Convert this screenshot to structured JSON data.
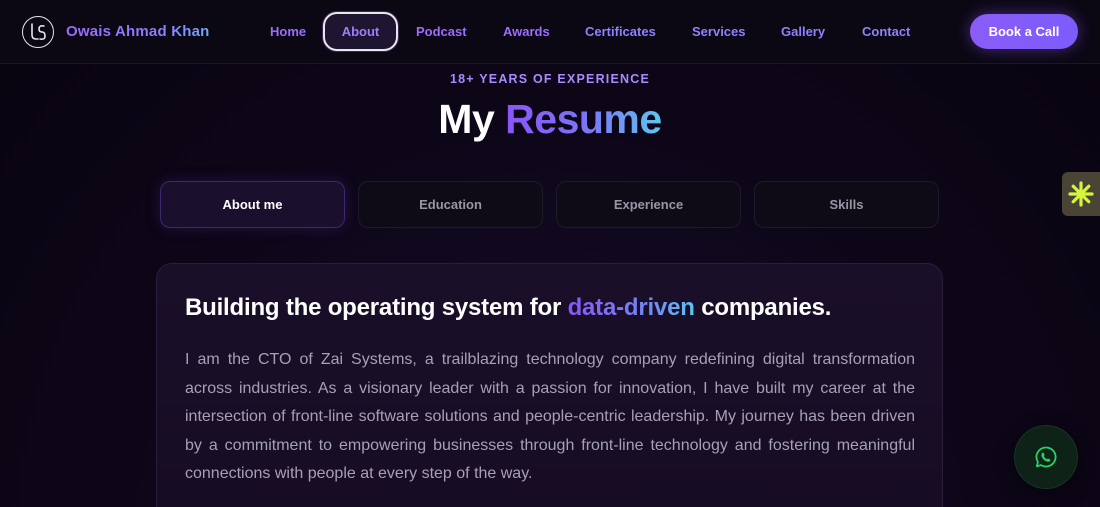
{
  "nav": {
    "brand": "Owais Ahmad Khan",
    "links": [
      {
        "label": "Home"
      },
      {
        "label": "About"
      },
      {
        "label": "Podcast"
      },
      {
        "label": "Awards"
      },
      {
        "label": "Certificates"
      },
      {
        "label": "Services"
      },
      {
        "label": "Gallery"
      },
      {
        "label": "Contact"
      }
    ],
    "active": "About",
    "cta": "Book a Call",
    "logo_icon": "monogram-logo-icon"
  },
  "hero": {
    "kicker": "18+ YEARS OF EXPERIENCE",
    "title_a": "My",
    "title_b": "Resume"
  },
  "tabs": [
    {
      "label": "About me",
      "active": true
    },
    {
      "label": "Education",
      "active": false
    },
    {
      "label": "Experience",
      "active": false
    },
    {
      "label": "Skills",
      "active": false
    }
  ],
  "card": {
    "title_before": "Building the operating system for",
    "title_highlight": "data-driven",
    "title_after": "companies.",
    "body": "I am the CTO of Zai Systems, a trailblazing technology company redefining digital transformation across industries. As a visionary leader with a passion for innovation, I have built my career at the intersection of front-line software solutions and people-centric leadership. My journey has been driven by a commitment to empowering businesses through front-line technology and fostering meaningful connections with people at every step of the way."
  },
  "widgets": {
    "side_icon": "asterisk-icon",
    "chat_icon": "whatsapp-icon"
  },
  "colors": {
    "accent": "#8b5cf6",
    "nav_link": "#9a6dff",
    "background": "#0d0618",
    "side_widget_icon": "#d4f53c",
    "whatsapp_icon": "#25d366"
  }
}
